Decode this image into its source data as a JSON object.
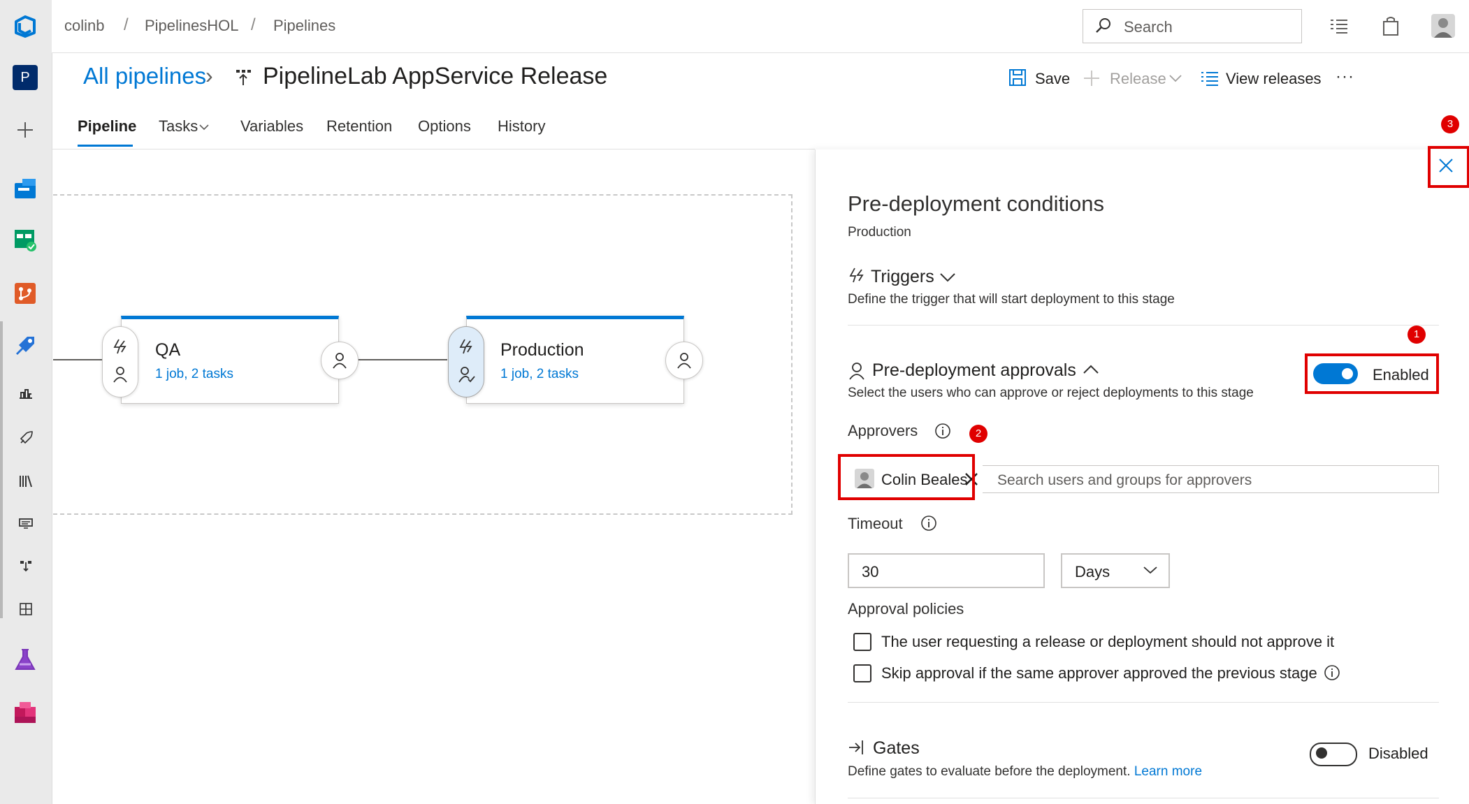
{
  "breadcrumb": {
    "org": "colinb",
    "project": "PipelinesHOL",
    "section": "Pipelines",
    "separator": "/"
  },
  "search": {
    "label": "Search"
  },
  "rail": {
    "project_initial": "P"
  },
  "header": {
    "all_pipelines": "All pipelines",
    "chevron": "›",
    "title": "PipelineLab AppService Release",
    "save": "Save",
    "release": "Release",
    "view_releases": "View releases",
    "more": "···"
  },
  "tabs": [
    {
      "label": "Pipeline",
      "active": true
    },
    {
      "label": "Tasks"
    },
    {
      "label": "Variables"
    },
    {
      "label": "Retention"
    },
    {
      "label": "Options"
    },
    {
      "label": "History"
    }
  ],
  "stages": [
    {
      "name": "QA",
      "summary": "1 job, 2 tasks"
    },
    {
      "name": "Production",
      "summary": "1 job, 2 tasks"
    }
  ],
  "panel": {
    "title": "Pre-deployment conditions",
    "stage": "Production",
    "triggers": {
      "label": "Triggers",
      "description": "Define the trigger that will start deployment to this stage"
    },
    "approvals": {
      "label": "Pre-deployment approvals",
      "description": "Select the users who can approve or reject deployments to this stage",
      "toggle_label": "Enabled",
      "enabled": true
    },
    "approvers": {
      "label": "Approvers",
      "chip": "Colin Beales",
      "placeholder": "Search users and groups for approvers"
    },
    "timeout": {
      "label": "Timeout",
      "value": "30",
      "unit": "Days"
    },
    "policies": {
      "label": "Approval policies",
      "items": [
        {
          "label": "The user requesting a release or deployment should not approve it",
          "checked": false
        },
        {
          "label": "Skip approval if the same approver approved the previous stage",
          "checked": false
        }
      ]
    },
    "gates": {
      "label": "Gates",
      "description": "Define gates to evaluate before the deployment.",
      "learn_more": "Learn more",
      "toggle_label": "Disabled",
      "enabled": false
    }
  },
  "annotations": {
    "one": "1",
    "two": "2",
    "three": "3"
  },
  "colors": {
    "accent": "#0078d4",
    "annotation_red": "#e00000",
    "toggle_on": "#0078d4",
    "toggle_off_border": "#323130"
  }
}
